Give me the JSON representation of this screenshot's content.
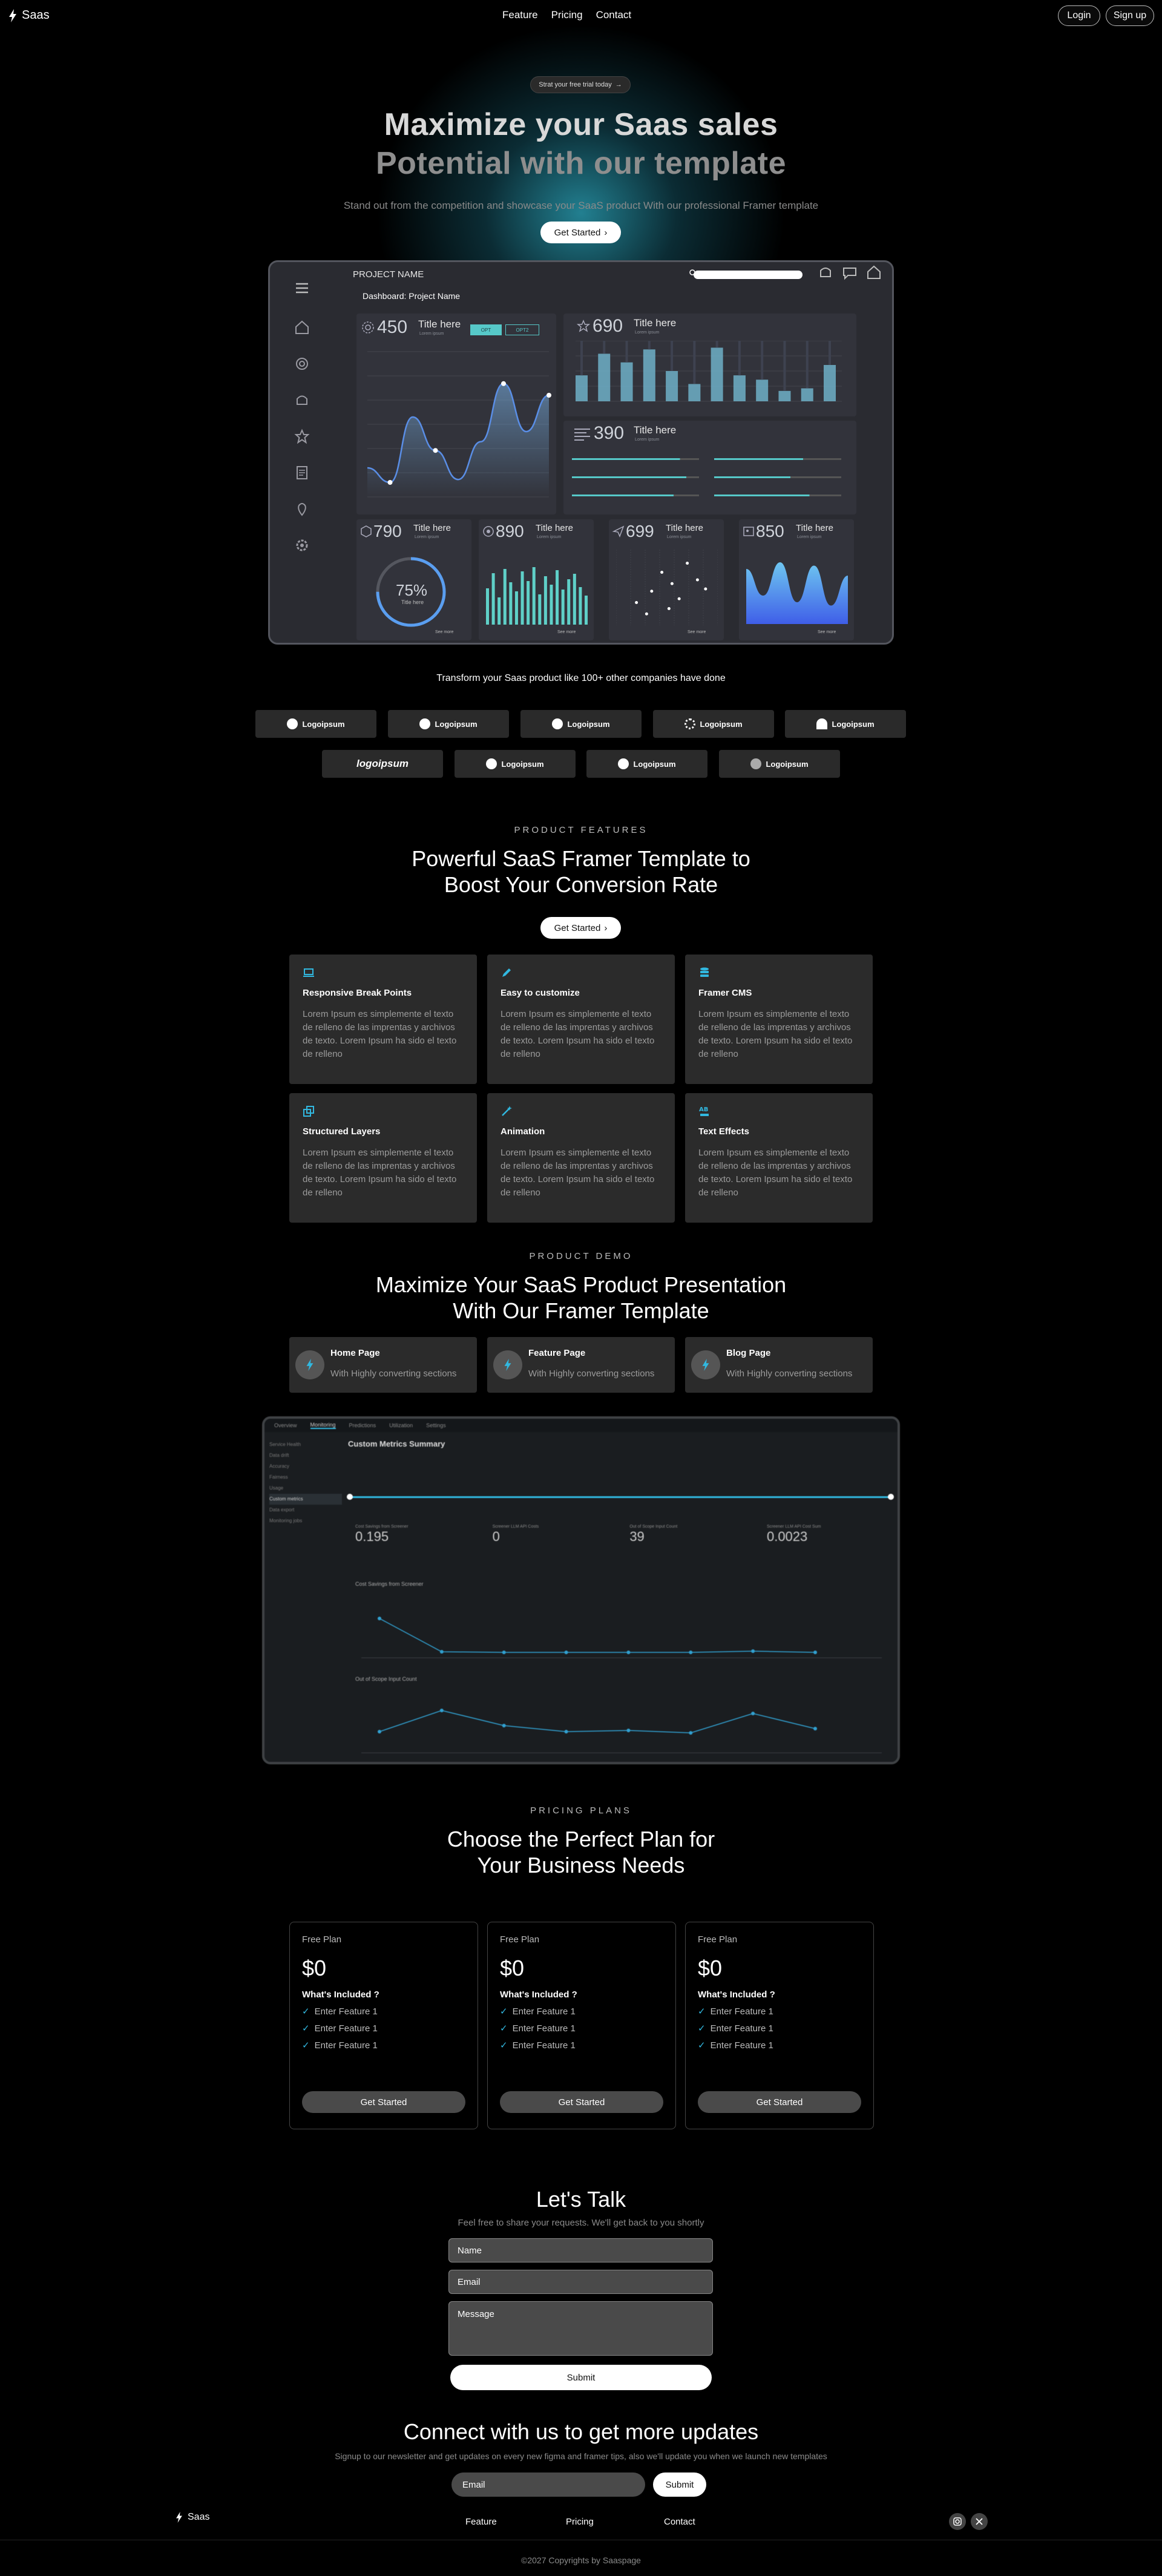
{
  "nav": {
    "brand": "Saas",
    "links": [
      "Feature",
      "Pricing",
      "Contact"
    ],
    "login": "Login",
    "signup": "Sign up"
  },
  "hero": {
    "pill": "Strat your free trial today",
    "title_line1": "Maximize your Saas sales",
    "title_line2": "Potential with our template",
    "subtitle": "Stand out from the competition and showcase your SaaS product With our professional Framer template",
    "cta": "Get Started"
  },
  "dashboard": {
    "project_name": "PROJECT NAME",
    "breadcrumb_label": "Dashboard:",
    "breadcrumb_value": "Project Name",
    "sidebar_icons": [
      "menu-icon",
      "home-icon",
      "settings-icon",
      "bell-icon",
      "star-icon",
      "document-icon",
      "location-icon",
      "gear-icon"
    ],
    "cards": [
      {
        "value": "450",
        "title": "Title here",
        "sub": "Lorem ipsum",
        "toggle": [
          "OPT",
          "OPT2"
        ]
      },
      {
        "value": "690",
        "title": "Title here",
        "sub": "Lorem ipsum"
      },
      {
        "value": "390",
        "title": "Title here",
        "sub": "Lorem ipsum"
      },
      {
        "value": "790",
        "title": "Title here",
        "sub": "Lorem ipsum",
        "gauge": "75%",
        "gauge_label": "Title here",
        "link": "See more"
      },
      {
        "value": "890",
        "title": "Title here",
        "sub": "Lorem ipsum",
        "link": "See more"
      },
      {
        "value": "699",
        "title": "Title here",
        "sub": "Lorem ipsum",
        "link": "See more"
      },
      {
        "value": "850",
        "title": "Title here",
        "sub": "Lorem ipsum",
        "link": "See more"
      }
    ],
    "line_chart": {
      "type": "line",
      "x": [
        0,
        1,
        2,
        3,
        4,
        5,
        6,
        7,
        8
      ],
      "values": [
        20,
        10,
        55,
        32,
        12,
        38,
        78,
        45,
        70
      ],
      "ylim": [
        0,
        100
      ]
    },
    "bar_chart": {
      "type": "bar",
      "values": [
        30,
        55,
        45,
        60,
        35,
        20,
        62,
        30,
        25,
        12,
        15,
        42
      ],
      "ylim": [
        0,
        70
      ]
    },
    "progress_fractions": [
      0.85,
      0.7,
      0.9,
      0.6,
      0.8,
      0.75
    ],
    "gauge_fraction": 0.75,
    "mini_bars": [
      60,
      85,
      45,
      92,
      70,
      55,
      88,
      72,
      95,
      50,
      80,
      66,
      90,
      58,
      75,
      84,
      62,
      48
    ],
    "scatter_points": [
      [
        20,
        30
      ],
      [
        35,
        45
      ],
      [
        45,
        70
      ],
      [
        55,
        55
      ],
      [
        62,
        35
      ],
      [
        70,
        82
      ],
      [
        80,
        60
      ],
      [
        88,
        48
      ],
      [
        30,
        15
      ],
      [
        52,
        22
      ]
    ],
    "area_values": [
      80,
      40,
      90,
      30,
      85,
      25,
      70
    ]
  },
  "logos": {
    "heading": "Transform your Saas product like 100+ other companies have done",
    "row1": [
      "Logoipsum",
      "Logoipsum",
      "Logoipsum",
      "Logoipsum",
      "Logoipsum"
    ],
    "row2": [
      "logoipsum",
      "Logoipsum",
      "Logoipsum",
      "Logoipsum"
    ]
  },
  "features": {
    "kicker": "PRODUCT FEATURES",
    "title_line1": "Powerful SaaS Framer Template to",
    "title_line2": "Boost Your Conversion Rate",
    "cta": "Get Started",
    "items": [
      {
        "icon": "laptop-icon",
        "title": "Responsive Break Points",
        "desc": "Lorem Ipsum es simplemente el texto de relleno de las imprentas y archivos de texto. Lorem Ipsum ha sido el texto de relleno"
      },
      {
        "icon": "pencil-icon",
        "title": "Easy to customize",
        "desc": "Lorem Ipsum es simplemente el texto de relleno de las imprentas y archivos de texto. Lorem Ipsum ha sido el texto de relleno"
      },
      {
        "icon": "database-icon",
        "title": "Framer CMS",
        "desc": "Lorem Ipsum es simplemente el texto de relleno de las imprentas y archivos de texto. Lorem Ipsum ha sido el texto de relleno"
      },
      {
        "icon": "layers-icon",
        "title": "Structured Layers",
        "desc": "Lorem Ipsum es simplemente el texto de relleno de las imprentas y archivos de texto. Lorem Ipsum ha sido el texto de relleno"
      },
      {
        "icon": "magic-wand-icon",
        "title": "Animation",
        "desc": "Lorem Ipsum es simplemente el texto de relleno de las imprentas y archivos de texto. Lorem Ipsum ha sido el texto de relleno"
      },
      {
        "icon": "text-effects-icon",
        "title": "Text Effects",
        "desc": "Lorem Ipsum es simplemente el texto de relleno de las imprentas y archivos de texto. Lorem Ipsum ha sido el texto de relleno"
      }
    ]
  },
  "demo": {
    "kicker": "PRODUCT DEMO",
    "title_line1": "Maximize Your SaaS Product Presentation",
    "title_line2": "With Our Framer Template",
    "items": [
      {
        "title": "Home Page",
        "desc": "With Highly converting sections"
      },
      {
        "title": "Feature Page",
        "desc": "With Highly converting sections"
      },
      {
        "title": "Blog Page",
        "desc": "With Highly converting sections"
      }
    ],
    "screenshot": {
      "tabs": [
        "Overview",
        "Monitoring",
        "Predictions",
        "Utilization",
        "Settings"
      ],
      "side": [
        "Service Health",
        "Data drift",
        "Accuracy",
        "Fairness",
        "Usage",
        "Custom metrics",
        "Data export",
        "Monitoring jobs"
      ],
      "title": "Custom Metrics Summary",
      "kpis": [
        "0.195",
        "0",
        "39",
        "0.0023"
      ],
      "kpi_titles": [
        "Cost Savings from Screener",
        "Screener LLM API Costs",
        "Out of Scope Input Count",
        "Screener LLM API Cost Sum"
      ],
      "chart1_title": "Cost Savings from Screener",
      "chart2_title": "Out of Scope Input Count",
      "chart1_values": [
        60,
        5,
        4,
        4,
        4,
        4,
        6,
        4
      ],
      "chart2_values": [
        30,
        65,
        40,
        30,
        32,
        28,
        60,
        35
      ]
    }
  },
  "pricing": {
    "kicker": "PRICING PLANS",
    "title_line1": "Choose the Perfect Plan for",
    "title_line2": "Your Business Needs",
    "plans": [
      {
        "name": "Free Plan",
        "price": "$0",
        "included": "What's Included ?",
        "features": [
          "Enter Feature 1",
          "Enter Feature 1",
          "Enter Feature 1"
        ],
        "cta": "Get Started"
      },
      {
        "name": "Free Plan",
        "price": "$0",
        "included": "What's Included ?",
        "features": [
          "Enter Feature 1",
          "Enter Feature 1",
          "Enter Feature 1"
        ],
        "cta": "Get Started"
      },
      {
        "name": "Free Plan",
        "price": "$0",
        "included": "What's Included ?",
        "features": [
          "Enter Feature 1",
          "Enter Feature 1",
          "Enter Feature 1"
        ],
        "cta": "Get Started"
      }
    ]
  },
  "contact": {
    "title": "Let's Talk",
    "subtitle": "Feel free to share your requests. We'll get back to you shortly",
    "name_placeholder": "Name",
    "email_placeholder": "Email",
    "message_placeholder": "Message",
    "submit": "Submit"
  },
  "newsletter": {
    "title": "Connect with us to get more updates",
    "subtitle": "Signup to our newsletter and get updates on every new figma and framer tips, also we'll update you when we launch new templates",
    "email_placeholder": "Email",
    "submit": "Submit"
  },
  "footer": {
    "brand": "Saas",
    "links": [
      "Feature",
      "Pricing",
      "Contact"
    ],
    "social": [
      "instagram-icon",
      "x-icon"
    ],
    "copyright": "©2027 Copyrights by Saaspage"
  },
  "colors": {
    "accent": "#31b8e0",
    "hero_glow": "#2a9aaa",
    "card_bg": "#2b2b2b"
  }
}
